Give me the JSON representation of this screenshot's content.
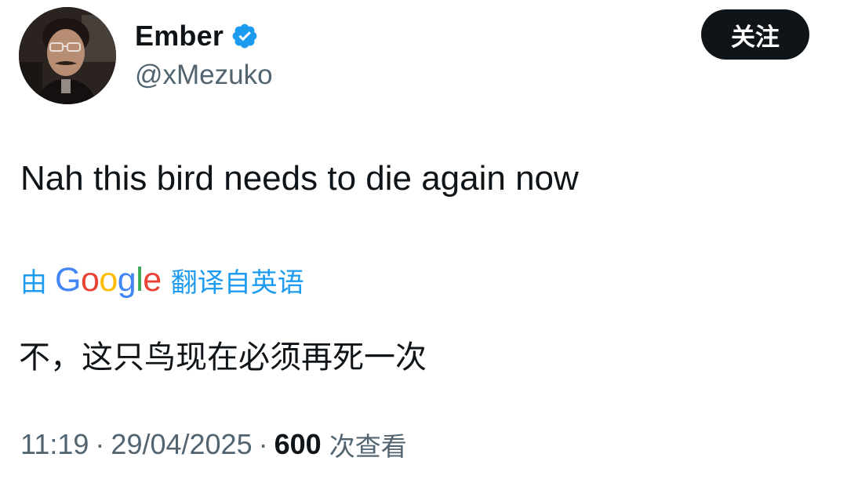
{
  "author": {
    "display_name": "Ember",
    "handle": "@xMezuko",
    "verified": true,
    "avatar_icon": "user-avatar"
  },
  "follow_button": {
    "label": "关注"
  },
  "tweet": {
    "text": "Nah this bird needs to die again now"
  },
  "translation": {
    "prefix": "由",
    "provider": "Google",
    "suffix": "翻译自英语",
    "translated_text": "不，这只鸟现在必须再死一次"
  },
  "meta": {
    "time": "11:19",
    "separator": "·",
    "date": "29/04/2025",
    "views_count": "600",
    "views_label": "次查看"
  },
  "colors": {
    "accent": "#1d9bf0",
    "text": "#0f1419",
    "secondary": "#536471",
    "button_bg": "#0f1419",
    "google_blue": "#4285f4",
    "google_red": "#ea4335",
    "google_yellow": "#fbbc05",
    "google_green": "#34a853"
  }
}
